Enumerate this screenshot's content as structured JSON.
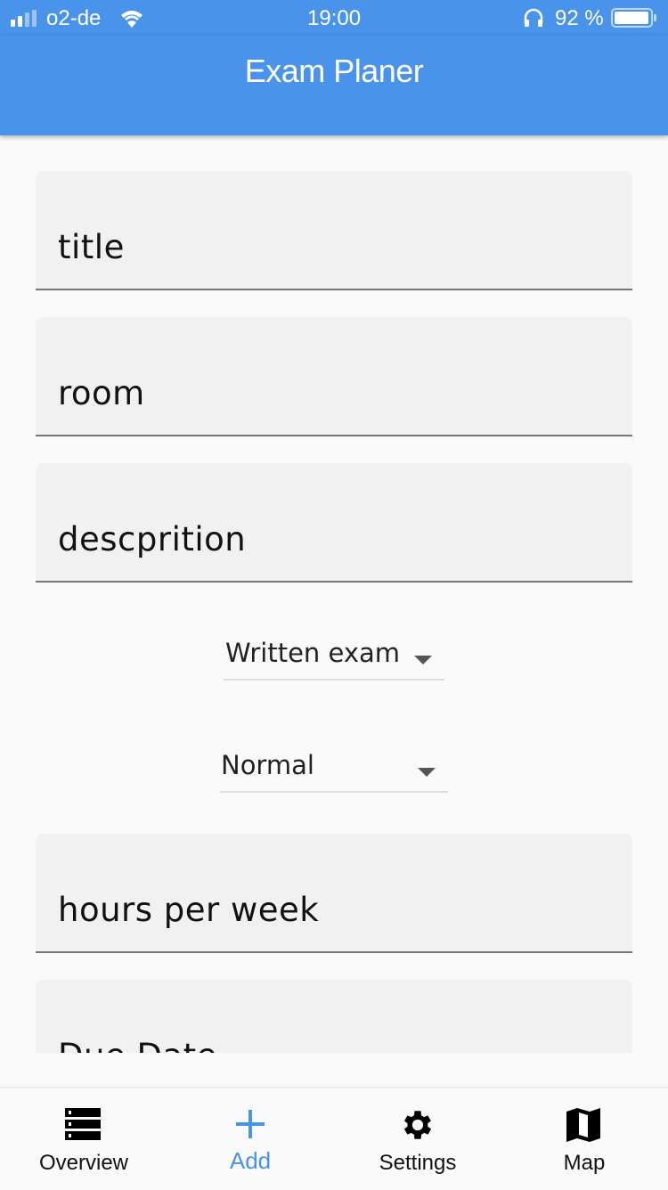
{
  "status": {
    "carrier": "o2-de",
    "time": "19:00",
    "battery": "92 %"
  },
  "appbar": {
    "title": "Exam Planer"
  },
  "form": {
    "title_placeholder": "title",
    "room_placeholder": "room",
    "description_placeholder": "descprition",
    "exam_type": "Written exam",
    "priority": "Normal",
    "hours_placeholder": "hours per week",
    "due_date_placeholder": "Due Date"
  },
  "nav": {
    "items": [
      {
        "label": "Overview",
        "icon": "list-icon"
      },
      {
        "label": "Add",
        "icon": "plus-icon"
      },
      {
        "label": "Settings",
        "icon": "gear-icon"
      },
      {
        "label": "Map",
        "icon": "map-icon"
      }
    ],
    "active": "Add"
  },
  "colors": {
    "primary": "#4A93EA"
  }
}
